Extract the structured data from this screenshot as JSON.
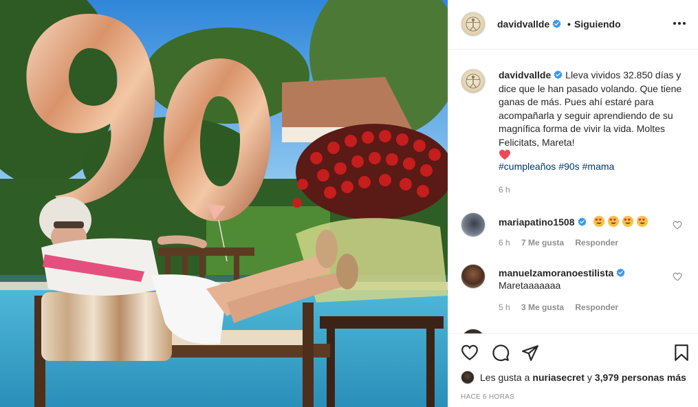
{
  "post": {
    "username": "davidvallde",
    "separator": "•",
    "follow_state": "Siguiendo",
    "caption": {
      "username": "davidvallde",
      "text": "Lleva vividos 32.850 días y dice que le han pasado volando. Que tiene ganas de más. Pues ahí estaré para acompañarla y seguir aprendiendo de su magnífica forma de vivir la vida. Moltes Felicitats, Mareta!",
      "hashtags": [
        "#cumpleaños",
        "#90s",
        "#mama"
      ],
      "time": "6 h"
    },
    "comments": [
      {
        "username": "mariapatino1508",
        "text": "",
        "emoji_count": 4,
        "time": "6 h",
        "likes": "7 Me gusta",
        "reply": "Responder"
      },
      {
        "username": "manuelzamoranoestilista",
        "text": "Maretaaaaaaa",
        "time": "5 h",
        "likes": "3 Me gusta",
        "reply": "Responder"
      }
    ],
    "likes_summary": {
      "prefix": "Les gusta a",
      "user": "nuriasecret",
      "connector": "y",
      "others": "3,979 personas más"
    },
    "posted_ago": "HACE 6 HORAS"
  },
  "photo": {
    "balloon_number": "90"
  },
  "icons": {
    "verified": "verified-badge-icon",
    "more": "more-options-icon",
    "like": "heart-outline-icon",
    "comment": "comment-bubble-icon",
    "share": "paper-plane-icon",
    "save": "bookmark-icon"
  },
  "colors": {
    "verified_blue": "#3897f0",
    "hashtag_blue": "#00376b",
    "muted_gray": "#8e8e8e",
    "text_dark": "#262626",
    "heart_red": "#ed4956"
  }
}
